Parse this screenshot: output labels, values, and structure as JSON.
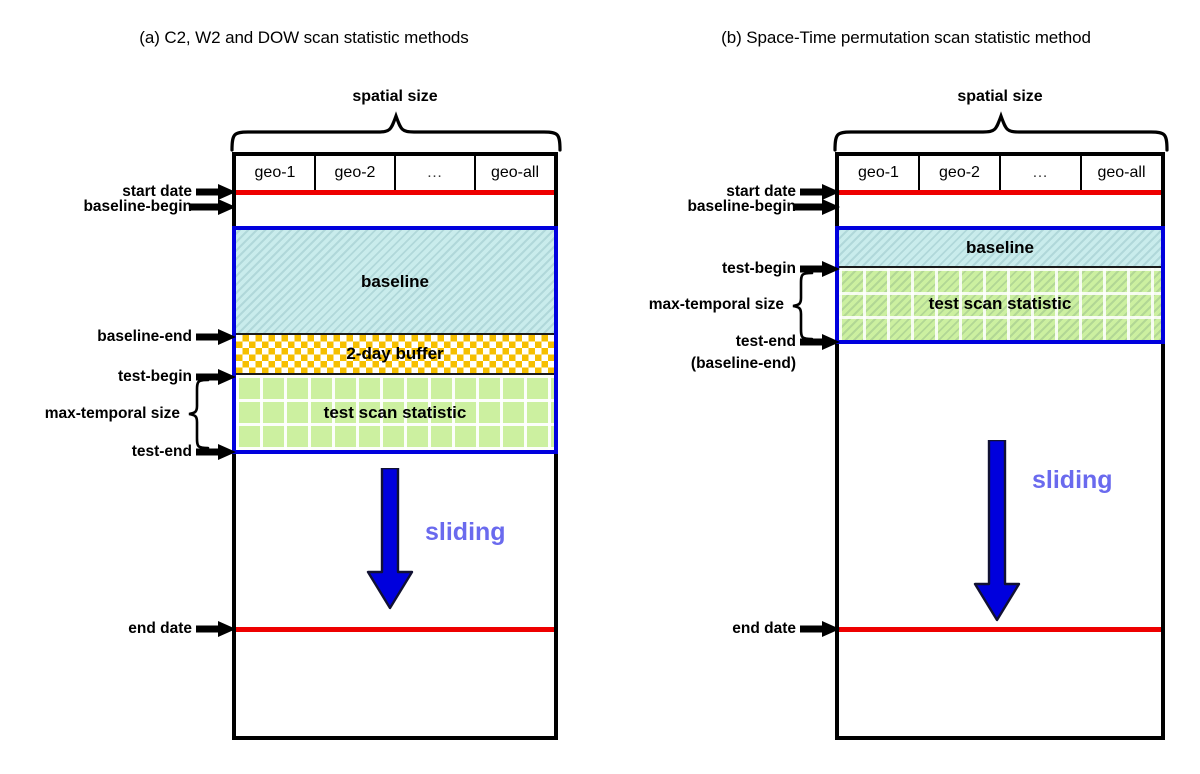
{
  "figure": {
    "caption_a": "(a) C2, W2 and DOW scan statistic methods",
    "caption_b": "(b) Space-Time permutation scan statistic method"
  },
  "colors": {
    "date_line": "#ee0000",
    "scan_frame": "#0000dd",
    "baseline_fill": "#c9ecec",
    "buffer_fill": "#f5bf00",
    "test_fill": "#ccf0a0",
    "sliding_text": "#6a6aee",
    "arrow_fill": "#0000dd",
    "box_border": "#000000"
  },
  "panel_a": {
    "title": "(a) C2, W2 and DOW scan statistic methods",
    "spatial_label": "spatial size",
    "geo_cells": [
      "geo-1",
      "geo-2",
      "…",
      "geo-all"
    ],
    "bands": [
      {
        "name": "baseline",
        "label": "baseline"
      },
      {
        "name": "buffer",
        "label": "2-day buffer"
      },
      {
        "name": "test",
        "label": "test scan statistic"
      }
    ],
    "markers": [
      {
        "name": "start-date",
        "label": "start date"
      },
      {
        "name": "baseline-begin",
        "label": "baseline-begin"
      },
      {
        "name": "baseline-end",
        "label": "baseline-end"
      },
      {
        "name": "test-begin",
        "label": "test-begin"
      },
      {
        "name": "test-end",
        "label": "test-end"
      },
      {
        "name": "end-date",
        "label": "end date"
      }
    ],
    "temporal_brace_label": "max-temporal size",
    "sliding_label": "sliding"
  },
  "panel_b": {
    "title": "(b) Space-Time permutation scan statistic method",
    "spatial_label": "spatial size",
    "geo_cells": [
      "geo-1",
      "geo-2",
      "…",
      "geo-all"
    ],
    "bands": [
      {
        "name": "baseline",
        "label": "baseline"
      },
      {
        "name": "test",
        "label": "test scan statistic"
      }
    ],
    "markers": [
      {
        "name": "start-date",
        "label": "start date"
      },
      {
        "name": "baseline-begin",
        "label": "baseline-begin"
      },
      {
        "name": "test-begin",
        "label": "test-begin"
      },
      {
        "name": "test-end",
        "label": "test-end"
      },
      {
        "name": "test-end-alias",
        "label": "(baseline-end)"
      },
      {
        "name": "end-date",
        "label": "end date"
      }
    ],
    "temporal_brace_label": "max-temporal size",
    "sliding_label": "sliding"
  }
}
